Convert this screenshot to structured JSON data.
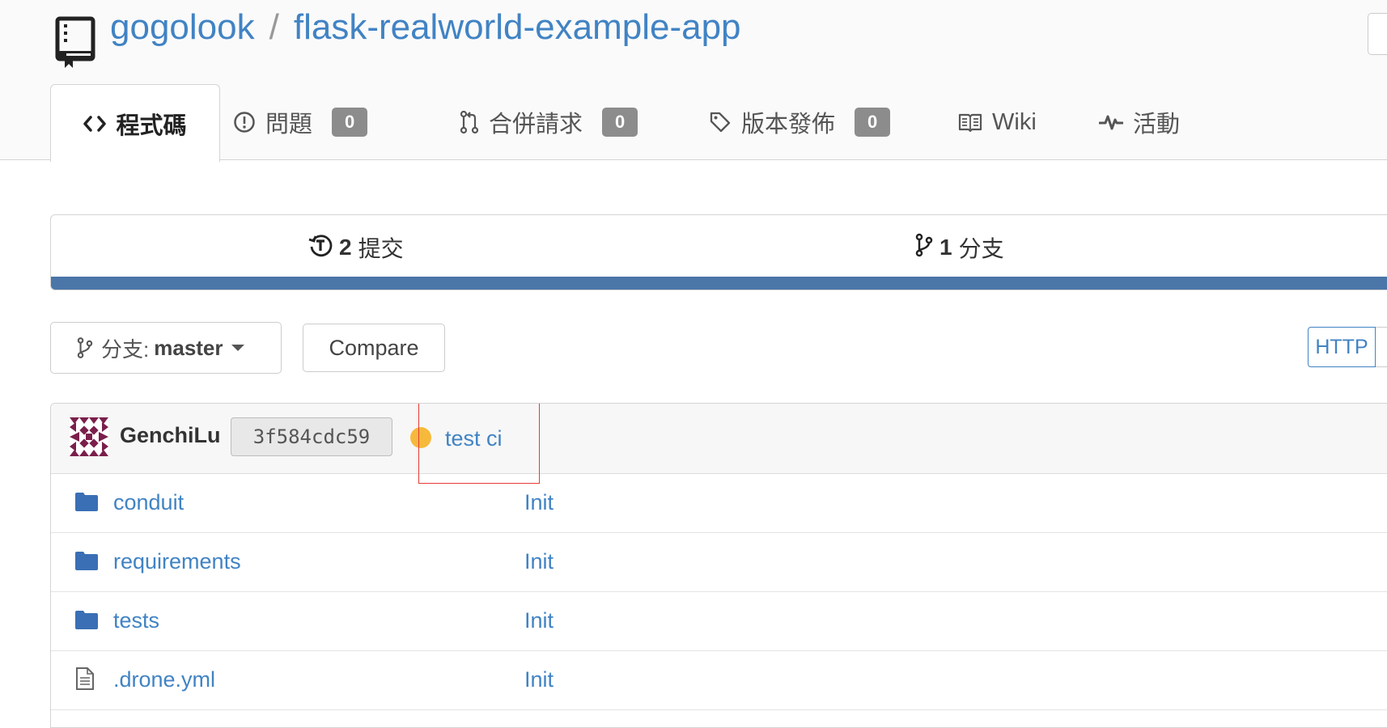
{
  "repo": {
    "owner": "gogolook",
    "separator": "/",
    "name": "flask-realworld-example-app"
  },
  "tabs": [
    {
      "label": "程式碼",
      "icon": "code-icon",
      "active": true
    },
    {
      "label": "問題",
      "icon": "issue-icon",
      "count": "0"
    },
    {
      "label": "合併請求",
      "icon": "pull-request-icon",
      "count": "0"
    },
    {
      "label": "版本發佈",
      "icon": "tag-icon",
      "count": "0"
    },
    {
      "label": "Wiki",
      "icon": "book-icon"
    },
    {
      "label": "活動",
      "icon": "pulse-icon"
    }
  ],
  "stats": {
    "commits_count": "2",
    "commits_label": "提交",
    "branches_count": "1",
    "branches_label": "分支"
  },
  "toolbar": {
    "branch_prefix": "分支:",
    "branch_name": "master",
    "compare_label": "Compare",
    "clone_protocol": "HTTP"
  },
  "latest_commit": {
    "author": "GenchiLu",
    "sha": "3f584cdc59",
    "status_color": "#f6b93b",
    "message": "test ci"
  },
  "files": [
    {
      "name": "conduit",
      "type": "folder",
      "commit_message": "Init"
    },
    {
      "name": "requirements",
      "type": "folder",
      "commit_message": "Init"
    },
    {
      "name": "tests",
      "type": "folder",
      "commit_message": "Init"
    },
    {
      "name": ".drone.yml",
      "type": "file",
      "commit_message": "Init"
    }
  ],
  "colors": {
    "link": "#4183c4",
    "progress_bar": "#4a76a8",
    "badge": "#8c8c8c",
    "highlight": "#e53935"
  }
}
